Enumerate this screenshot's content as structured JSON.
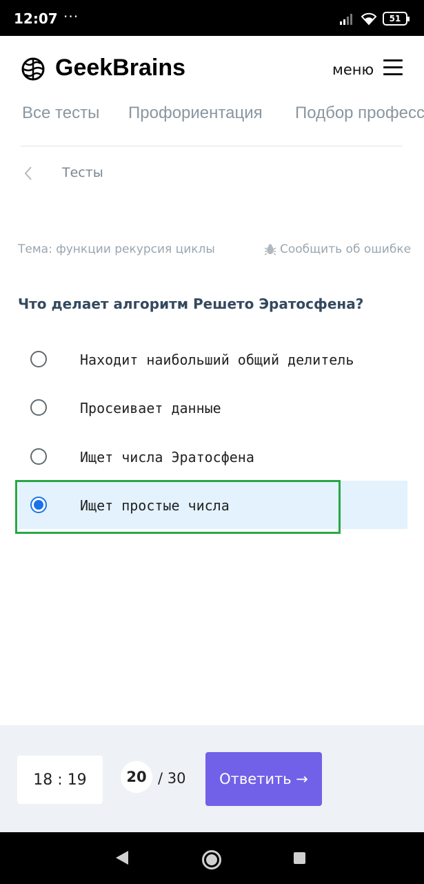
{
  "status_bar": {
    "time": "12:07",
    "dots": "···",
    "battery": "51"
  },
  "header": {
    "logo_text": "GeekBrains",
    "menu_label": "меню"
  },
  "tabs": [
    {
      "label": "Все тесты"
    },
    {
      "label": "Профориентация"
    },
    {
      "label": "Подбор профессии"
    }
  ],
  "breadcrumb": {
    "label": "Тесты"
  },
  "topic": {
    "text": "Тема: функции рекурсия циклы",
    "report_label": "Сообщить об ошибке"
  },
  "question": {
    "text": "Что делает алгоритм Решето Эратосфена?",
    "options": [
      {
        "label": "Находит наибольший общий делитель",
        "selected": false
      },
      {
        "label": "Просеивает данные",
        "selected": false
      },
      {
        "label": "Ищет числа Эратосфена",
        "selected": false
      },
      {
        "label": "Ищет простые числа",
        "selected": true
      }
    ]
  },
  "footer": {
    "timer": "18 : 19",
    "current": "20",
    "total_sep": "/ 30",
    "submit_label": "Ответить →"
  },
  "colors": {
    "accent": "#7161e8",
    "radio_selected": "#1a73e8",
    "selected_bg": "#e3f2fd",
    "highlight_border": "#28a745"
  },
  "icons": {
    "logo": "brain-icon",
    "menu": "hamburger-icon",
    "back": "chevron-left-icon",
    "report": "bug-icon"
  }
}
